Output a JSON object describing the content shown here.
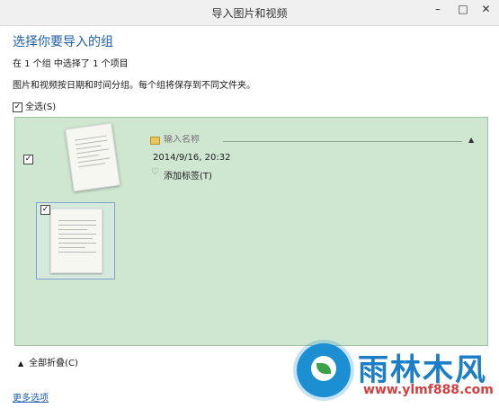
{
  "window": {
    "title": "导入图片和视频",
    "minimize": "–",
    "maximize": "□",
    "close": "✕"
  },
  "heading": "选择你要导入的组",
  "selection_summary": "在 1 个组 中选择了 1 个项目",
  "grouping_info": "图片和视频按日期和时间分组。每个组将保存到不同文件夹。",
  "select_all": {
    "label": "全选(S)",
    "checked": true
  },
  "group": {
    "checked": true,
    "name_placeholder": "输入名称",
    "date": "2014/9/16, 20:32",
    "add_tag": "添加标签(T)",
    "collapse_arrow": "▲",
    "item_checked": true
  },
  "footer": {
    "collapse_all": "全部折叠(C)",
    "collapse_arrow": "▲",
    "more_options": "更多选项"
  },
  "watermark": {
    "name": "雨林木风",
    "url": "www.ylmf888.com"
  },
  "colors": {
    "accent": "#1e5fa8",
    "group_bg": "#cfe6d1",
    "watermark_blue": "#1c7ec7",
    "watermark_red": "#d04040"
  }
}
